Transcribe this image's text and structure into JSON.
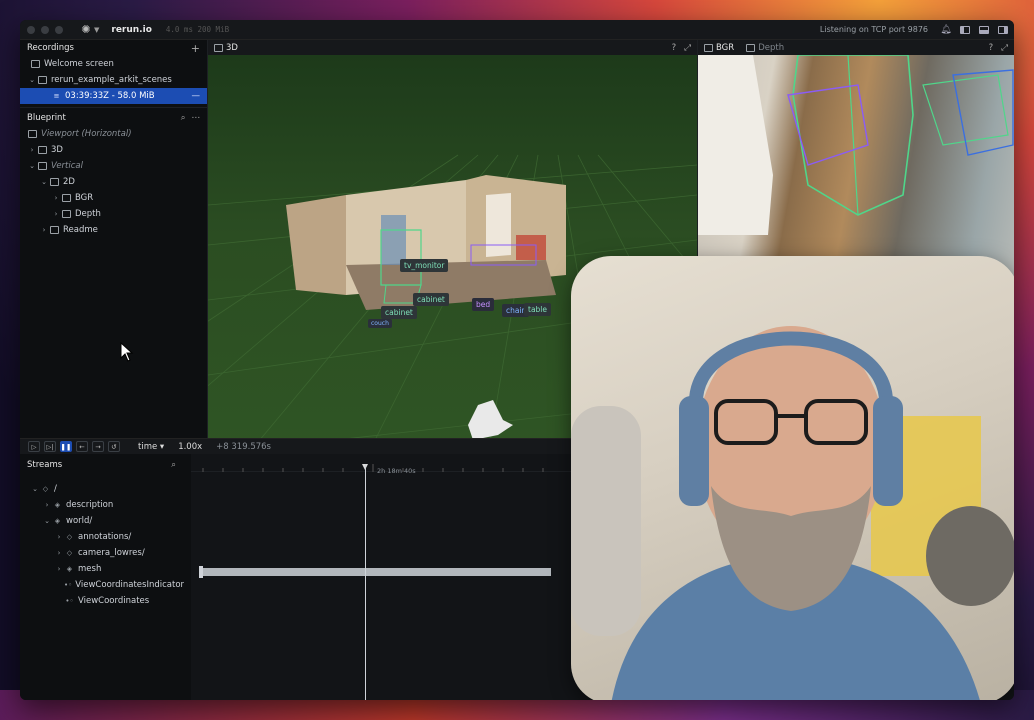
{
  "titlebar": {
    "app_name": "rerun.io",
    "perf": "4.0 ms 200 MiB",
    "status": "Listening on TCP port 9876"
  },
  "recordings": {
    "header": "Recordings",
    "items": [
      {
        "label": "Welcome screen"
      },
      {
        "label": "rerun_example_arkit_scenes"
      },
      {
        "label": "03:39:33Z - 58.0 MiB"
      }
    ]
  },
  "blueprint": {
    "header": "Blueprint",
    "items": [
      {
        "label": "Viewport (Horizontal)"
      },
      {
        "label": "3D"
      },
      {
        "label": "Vertical"
      },
      {
        "label": "2D"
      },
      {
        "label": "BGR"
      },
      {
        "label": "Depth"
      },
      {
        "label": "Readme"
      }
    ]
  },
  "view3d": {
    "tab": "3D",
    "labels": [
      "tv_monitor",
      "cabinet",
      "cabinet",
      "bed",
      "chair",
      "table",
      "couch"
    ]
  },
  "view2d": {
    "tab_bgr": "BGR",
    "tab_depth": "Depth"
  },
  "timeline": {
    "timeline_name": "time",
    "speed": "1.00x",
    "current": "+8 319.576s",
    "ruler_label": "2h 18m 40s"
  },
  "streams": {
    "header": "Streams",
    "items": [
      {
        "label": "/"
      },
      {
        "label": "description"
      },
      {
        "label": "world/"
      },
      {
        "label": "annotations/"
      },
      {
        "label": "camera_lowres/"
      },
      {
        "label": "mesh"
      },
      {
        "label": "ViewCoordinatesIndicator"
      },
      {
        "label": "ViewCoordinates"
      }
    ]
  },
  "colors": {
    "accent": "#1c4db3",
    "label_green": "#7fe0b8",
    "box_green": "#4fd68a",
    "box_purple": "#8b5cf6",
    "box_blue": "#3b6fe0"
  }
}
